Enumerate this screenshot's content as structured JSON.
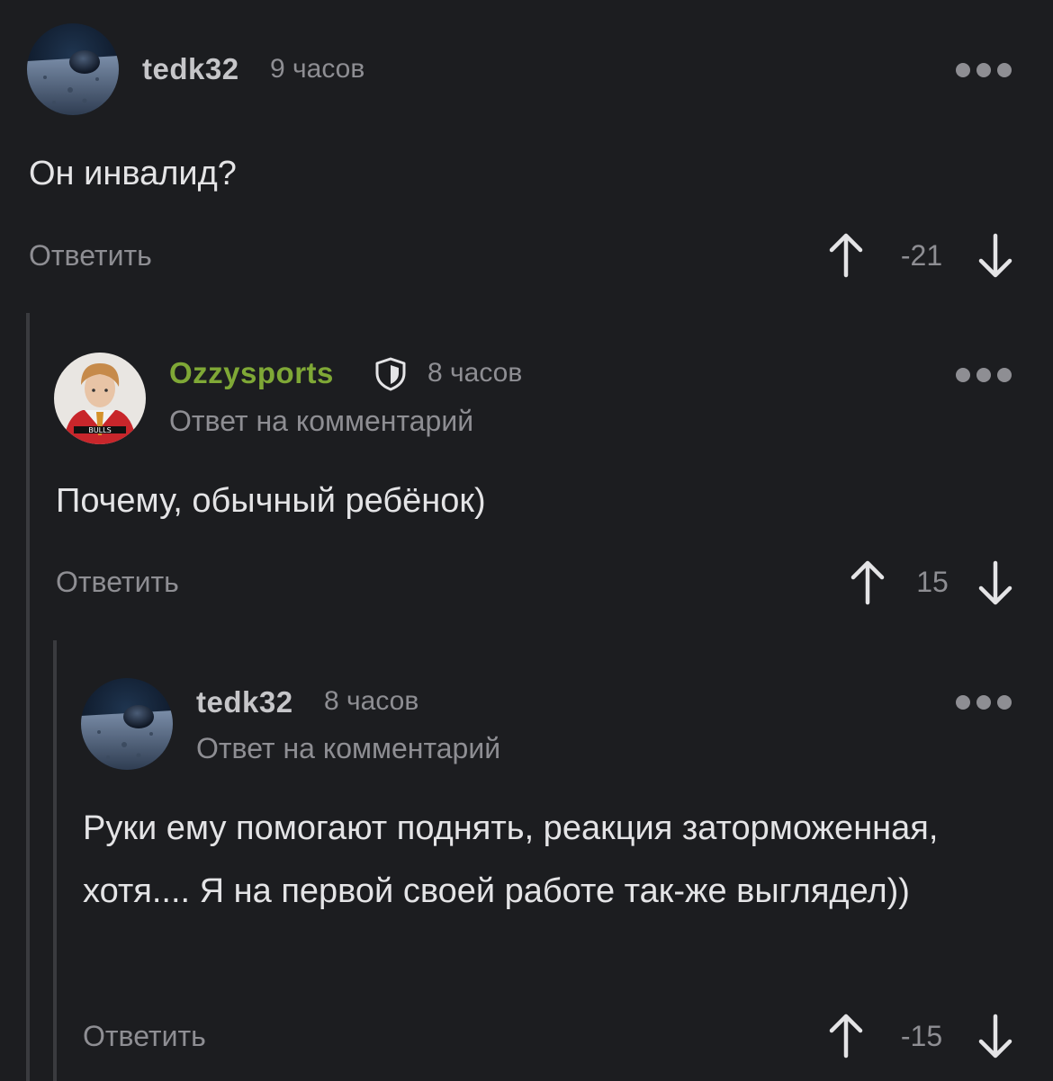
{
  "comments": [
    {
      "username": "tedk32",
      "time": "9 часов",
      "text": "Он инвалид?",
      "reply_label": "Ответить",
      "rating": "-21",
      "avatar_icon": "moon-surface-avatar",
      "more_icon": "ellipsis-icon"
    },
    {
      "username": "Ozzysports",
      "username_color": "#7fa836",
      "badge_icon": "shield-icon",
      "time": "8 часов",
      "subtitle": "Ответ на комментарий",
      "text": "Почему, обычный ребёнок)",
      "reply_label": "Ответить",
      "rating": "15",
      "avatar_icon": "person-red-jersey-avatar",
      "more_icon": "ellipsis-icon"
    },
    {
      "username": "tedk32",
      "time": "8 часов",
      "subtitle": "Ответ на комментарий",
      "text": "Руки ему помогают поднять, реакция заторможенная, хотя.... Я на первой своей работе так-же выглядел))",
      "reply_label": "Ответить",
      "rating": "-15",
      "avatar_icon": "moon-surface-avatar",
      "more_icon": "ellipsis-icon"
    }
  ],
  "colors": {
    "background": "#1c1d20",
    "text": "#e4e4e6",
    "muted": "#8e8e93",
    "accent_green": "#7fa836",
    "thread_line": "#3a3b3f"
  }
}
